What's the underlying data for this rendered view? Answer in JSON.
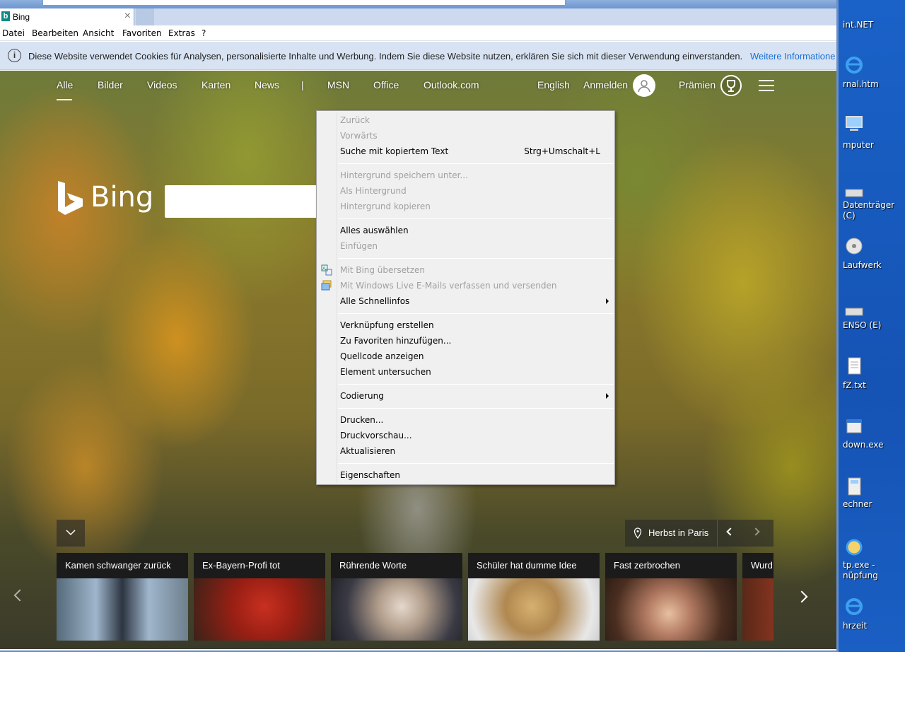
{
  "tab": {
    "title": "Bing"
  },
  "menubar": [
    "Datei",
    "Bearbeiten",
    "Ansicht",
    "Favoriten",
    "Extras",
    "?"
  ],
  "cookie_notice": {
    "text": "Diese Website verwendet Cookies für Analysen, personalisierte Inhalte und Werbung. Indem Sie diese Website nutzen, erklären Sie sich mit dieser Verwendung einverstanden.",
    "link": "Weitere Informatione"
  },
  "bing_nav": {
    "items": [
      "Alle",
      "Bilder",
      "Videos",
      "Karten",
      "News",
      "|",
      "MSN",
      "Office",
      "Outlook.com"
    ],
    "language": "English",
    "signin": "Anmelden",
    "rewards": "Prämien"
  },
  "logo": {
    "word": "Bing"
  },
  "context_menu": {
    "zurueck": "Zurück",
    "vorwaerts": "Vorwärts",
    "suche": "Suche mit kopiertem Text",
    "suche_shortcut": "Strg+Umschalt+L",
    "hg_speichern": "Hintergrund speichern unter...",
    "als_hg": "Als Hintergrund",
    "hg_kopieren": "Hintergrund kopieren",
    "alles": "Alles auswählen",
    "einfuegen": "Einfügen",
    "uebersetzen": "Mit Bing übersetzen",
    "email": "Mit Windows Live E-Mails verfassen und versenden",
    "schnellinfos": "Alle Schnellinfos",
    "verknuepfung": "Verknüpfung erstellen",
    "favoriten": "Zu Favoriten hinzufügen...",
    "quellcode": "Quellcode anzeigen",
    "element": "Element untersuchen",
    "codierung": "Codierung",
    "drucken": "Drucken...",
    "druckvorschau": "Druckvorschau...",
    "aktualisieren": "Aktualisieren",
    "eigenschaften": "Eigenschaften"
  },
  "location": {
    "text": "Herbst in Paris"
  },
  "cards": [
    {
      "title": "Kamen schwanger zurück"
    },
    {
      "title": "Ex-Bayern-Profi tot"
    },
    {
      "title": "Rührende Worte"
    },
    {
      "title": "Schüler hat dumme Idee"
    },
    {
      "title": "Fast zerbrochen"
    },
    {
      "title": "Wurd"
    }
  ],
  "desktop_icons": [
    {
      "label": "int.NET"
    },
    {
      "label": "rnal.htm"
    },
    {
      "label": "mputer"
    },
    {
      "label": "Datenträger\n(C)"
    },
    {
      "label": "Laufwerk"
    },
    {
      "label": "ENSO (E)"
    },
    {
      "label": "fZ.txt"
    },
    {
      "label": "down.exe"
    },
    {
      "label": "echner"
    },
    {
      "label": "tp.exe -\nnüpfung"
    },
    {
      "label": "hrzeit"
    }
  ]
}
